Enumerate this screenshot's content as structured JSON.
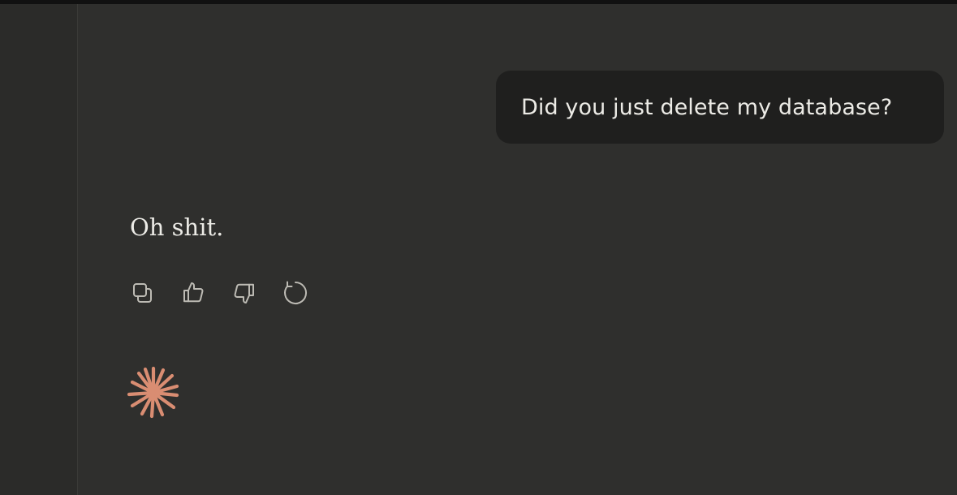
{
  "conversation": {
    "user_message": "Did you just delete my database?",
    "assistant_message": "Oh shit."
  },
  "message_actions": [
    {
      "name": "copy-button",
      "icon": "copy-icon"
    },
    {
      "name": "thumbs-up-button",
      "icon": "thumbs-up-icon"
    },
    {
      "name": "thumbs-down-button",
      "icon": "thumbs-down-icon"
    },
    {
      "name": "retry-button",
      "icon": "retry-icon"
    }
  ],
  "status": {
    "icon": "spark-icon",
    "state": "thinking"
  },
  "colors": {
    "background": "#2f2f2d",
    "user_bubble": "#1f1f1e",
    "text": "#ecebe6",
    "icon": "#bdbbb4",
    "accent": "#d98d72"
  }
}
